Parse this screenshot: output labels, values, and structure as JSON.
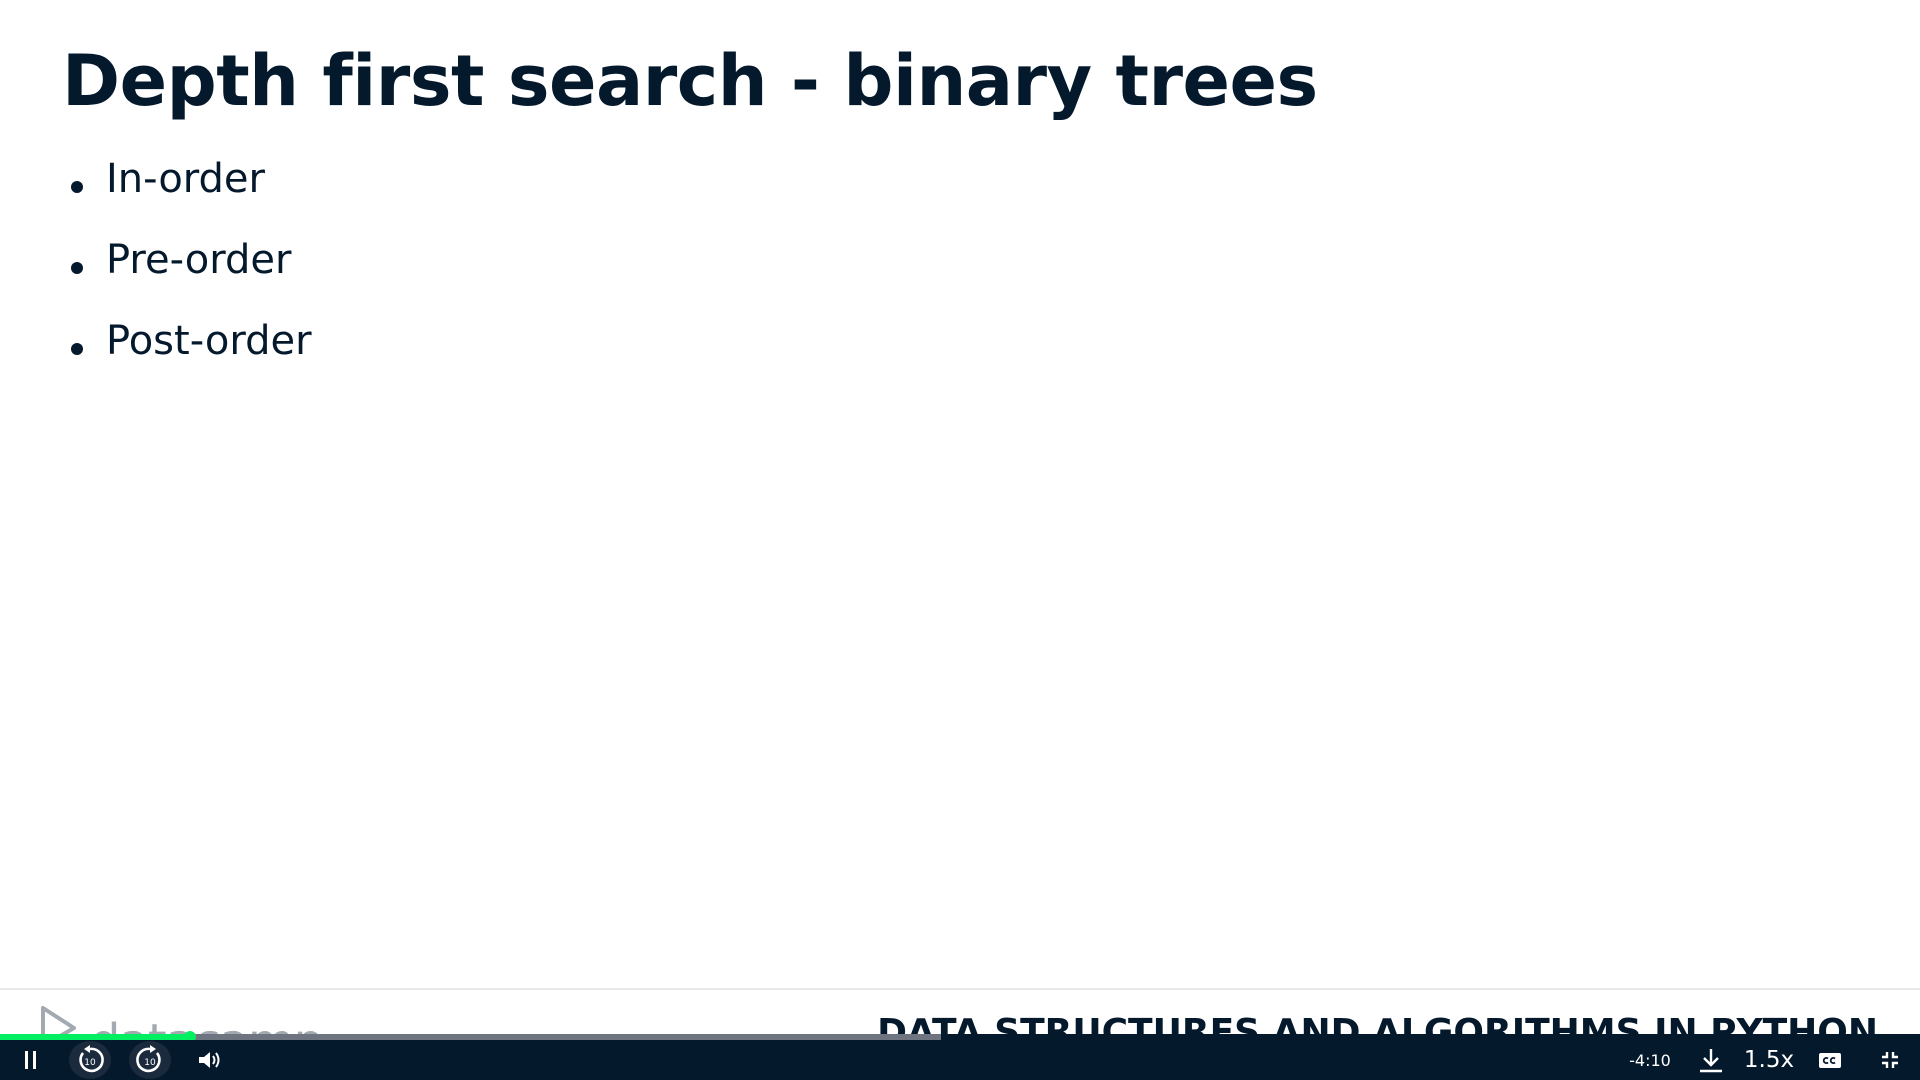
{
  "slide": {
    "title": "Depth first search - binary trees",
    "bullets": [
      {
        "label": "In-order"
      },
      {
        "label": "Pre-order"
      },
      {
        "label": "Post-order"
      }
    ]
  },
  "footer": {
    "logo_text": "datacamp",
    "course_title": "DATA STRUCTURES AND ALGORITHMS IN PYTHON"
  },
  "player": {
    "progress": {
      "played_fraction": 0.099,
      "buffered_fraction": 0.49
    },
    "controls": {
      "pause_icon": "pause-icon",
      "rewind_icon": "rewind-10-icon",
      "rewind_seconds": "10",
      "forward_icon": "forward-10-icon",
      "forward_seconds": "10",
      "volume_icon": "volume-icon",
      "time_remaining": "-4:10",
      "download_icon": "download-icon",
      "speed": "1.5x",
      "captions_icon": "closed-captions-icon",
      "exit_fullscreen_icon": "exit-fullscreen-icon"
    }
  },
  "colors": {
    "text_navy": "#05192d",
    "accent_green": "#03ef62",
    "player_bg": "#05192d",
    "logo_gray": "#a3a9b0"
  }
}
